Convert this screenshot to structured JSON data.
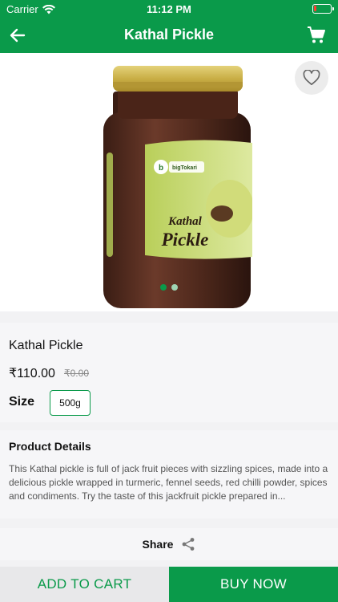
{
  "status_bar": {
    "carrier": "Carrier",
    "time": "11:12 PM"
  },
  "app_bar": {
    "title": "Kathal Pickle"
  },
  "product": {
    "image_label_brand": "bigTokari",
    "image_label_line1": "Kathal",
    "image_label_line2": "Pickle",
    "name": "Kathal Pickle",
    "price": "₹110.00",
    "mrp": "₹0.00",
    "size_label": "Size",
    "size_option": "500g"
  },
  "details": {
    "heading": "Product Details",
    "text": "This Kathal pickle is full of jack fruit pieces with sizzling spices, made into a delicious pickle wrapped in turmeric, fennel seeds, red chilli powder, spices and condiments. Try the taste of this jackfruit pickle prepared in..."
  },
  "share": {
    "label": "Share"
  },
  "actions": {
    "add_to_cart": "ADD TO CART",
    "buy_now": "BUY NOW"
  },
  "colors": {
    "brand_green": "#0a9a4a"
  },
  "icons": {
    "back": "arrow-left-icon",
    "cart": "cart-icon",
    "favorite": "heart-icon",
    "share": "share-icon",
    "wifi": "wifi-icon",
    "battery": "battery-icon"
  }
}
